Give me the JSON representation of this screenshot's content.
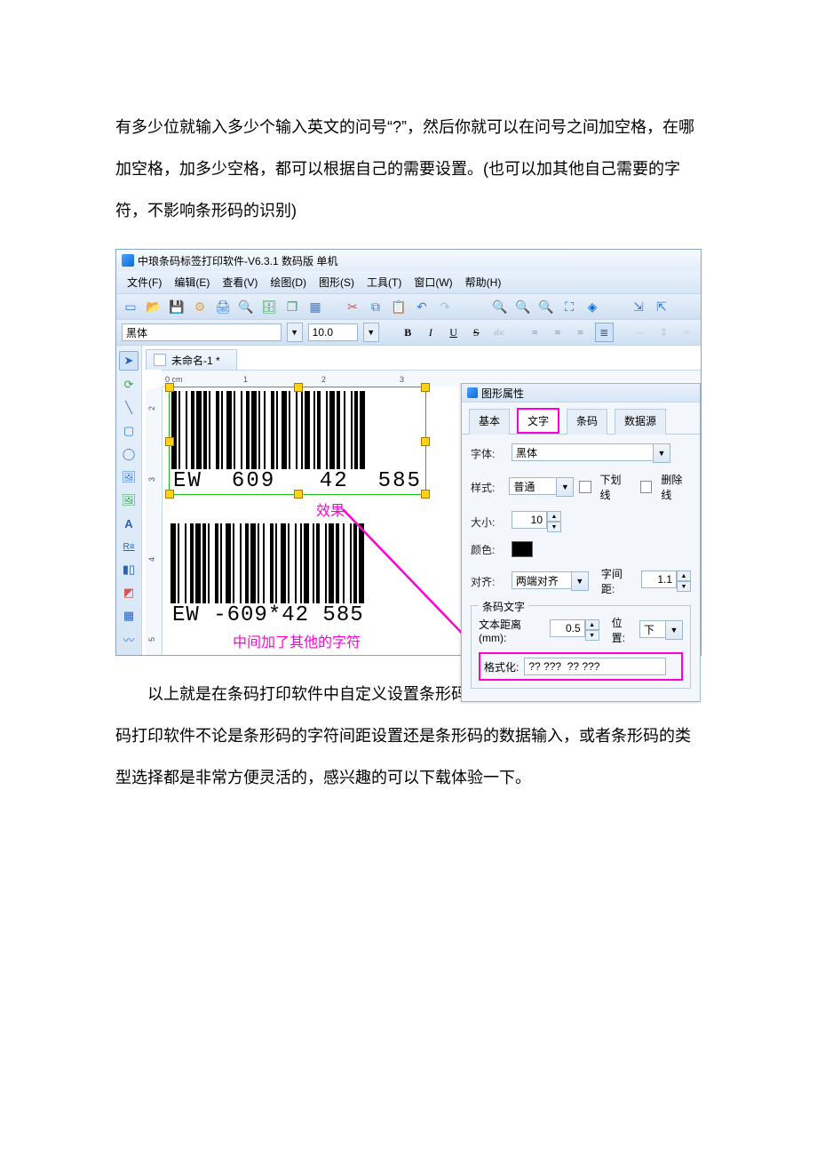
{
  "doc": {
    "para1": "有多少位就输入多少个输入英文的问号“?”，然后你就可以在问号之间加空格，在哪加空格，加多少空格，都可以根据自己的需要设置。(也可以加其他自己需要的字符，不影响条形码的识别)",
    "para2": "以上就是在条码打印软件中自定义设置条形码下面的字符间距的几种方法，条码打印软件不论是条形码的字符间距设置还是条形码的数据输入，或者条形码的类型选择都是非常方便灵活的，感兴趣的可以下载体验一下。"
  },
  "app": {
    "title": "中琅条码标签打印软件-V6.3.1 数码版 单机",
    "menu": [
      "文件(F)",
      "编辑(E)",
      "查看(V)",
      "绘图(D)",
      "图形(S)",
      "工具(T)",
      "窗口(W)",
      "帮助(H)"
    ],
    "document_tab": "未命名-1 *",
    "font_name": "黑体",
    "font_size": "10.0",
    "ruler_h": [
      "0 cm",
      "1",
      "2",
      "3"
    ],
    "ruler_v": [
      "2",
      "3",
      "4",
      "5"
    ],
    "barcode1_text": "EW  609   42  585",
    "barcode2_text": "EW  -609*42  585",
    "annot_effect": "效果",
    "annot_chars": "中间加了其他的字符"
  },
  "props": {
    "panel_title": "图形属性",
    "tabs": [
      "基本",
      "文字",
      "条码",
      "数据源"
    ],
    "font_label": "字体:",
    "font_value": "黑体",
    "style_label": "样式:",
    "style_value": "普通",
    "underline": "下划线",
    "strike": "删除线",
    "size_label": "大小:",
    "size_value": "10",
    "color_label": "颜色:",
    "align_label": "对齐:",
    "align_value": "两端对齐",
    "spacing_label": "字间距:",
    "spacing_value": "1.1",
    "group_title": "条码文字",
    "textdist_label": "文本距离(mm):",
    "textdist_value": "0.5",
    "pos_label": "位置:",
    "pos_value": "下",
    "format_label": "格式化:",
    "format_value": "?? ???  ?? ???"
  }
}
